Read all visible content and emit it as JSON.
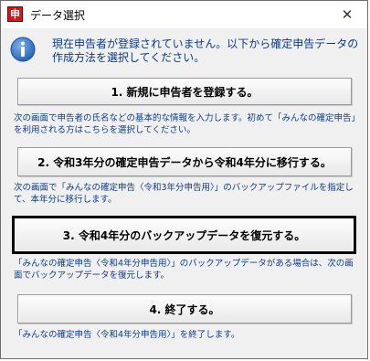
{
  "window": {
    "title": "データ選択",
    "app_icon_glyph": "申",
    "close_glyph": "✕"
  },
  "header": {
    "icon": "info-icon",
    "message": "現在申告者が登録されていません。以下から確定申告データの作成方法を選択してください。"
  },
  "options": [
    {
      "button_label": "1. 新規に申告者を登録する。",
      "description": "次の画面で申告者の氏名などの基本的な情報を入力します。初めて「みんなの確定申告」を利用される方はこちらを選択してください。"
    },
    {
      "button_label": "2. 令和3年分の確定申告データから令和4年分に移行する。",
      "description": "次の画面で「みんなの確定申告〈令和3年分申告用〉」のバックアップファイルを指定して、本年分に移行します。"
    },
    {
      "button_label": "3. 令和4年分のバックアップデータを復元する。",
      "description": "「みんなの確定申告〈令和4年分申告用〉」のバックアップデータがある場合は、次の画面でバックアップデータを復元します。"
    },
    {
      "button_label": "4. 終了する。",
      "description": "「みんなの確定申告〈令和4年分申告用〉」を終了します。"
    }
  ],
  "colors": {
    "message_text": "#0b3a8c",
    "app_icon_red": "#d21a1a",
    "info_icon_blue": "#2f6fc7"
  }
}
